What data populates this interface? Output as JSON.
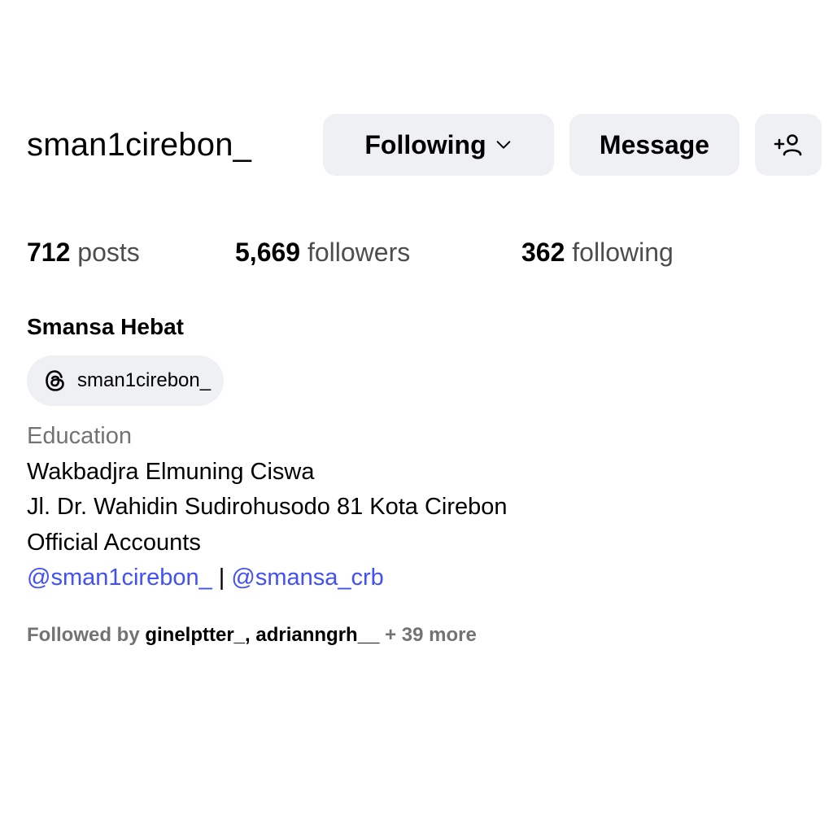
{
  "profile": {
    "username": "sman1cirebon_",
    "display_name": "Smansa Hebat",
    "threads_handle": "sman1cirebon_"
  },
  "actions": {
    "following_label": "Following",
    "message_label": "Message",
    "adduser_icon": "add-user-icon"
  },
  "stats": {
    "posts_count": "712",
    "posts_label": "posts",
    "followers_count": "5,669",
    "followers_label": "followers",
    "following_count": "362",
    "following_label": "following"
  },
  "bio": {
    "category": "Education",
    "line1": "Wakbadjra Elmuning Ciswa",
    "line2": "Jl. Dr. Wahidin Sudirohusodo 81 Kota Cirebon",
    "line3": "Official Accounts",
    "link1": "@sman1cirebon_",
    "separator": "|",
    "link2": "@smansa_crb"
  },
  "followed_by": {
    "prefix": "Followed by",
    "name1": "ginelptter_",
    "comma": ",",
    "name2": "adrianngrh__",
    "more": "+ 39 more"
  },
  "colors": {
    "button_bg": "#eff0f3",
    "link": "#4150f7",
    "secondary_text": "#737373"
  }
}
